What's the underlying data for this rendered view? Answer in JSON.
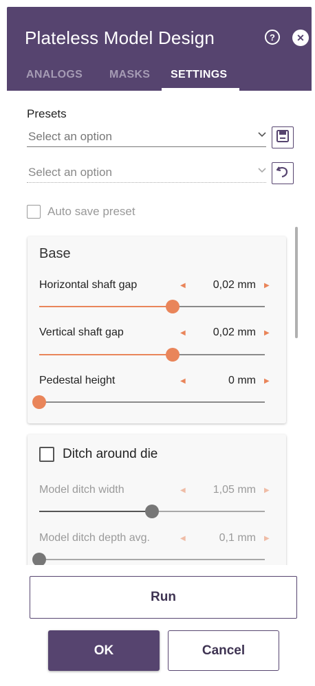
{
  "window": {
    "title": "Plateless Model Design",
    "accent": "#56446f",
    "slider_color": "#e9855a",
    "icons": [
      "help-icon",
      "close-icon",
      "save-icon",
      "undo-icon",
      "chevron-down-icon"
    ]
  },
  "tabs": [
    {
      "label": "ANALOGS",
      "active": false
    },
    {
      "label": "MASKS",
      "active": false
    },
    {
      "label": "SETTINGS",
      "active": true
    }
  ],
  "presets": {
    "label": "Presets",
    "select1_placeholder": "Select an option",
    "select2_placeholder": "Select an option",
    "auto_save_label": "Auto save preset",
    "auto_save_checked": false
  },
  "base": {
    "title": "Base",
    "params": [
      {
        "label": "Horizontal shaft gap",
        "value": "0,02 mm",
        "slider_fraction": 0.59
      },
      {
        "label": "Vertical shaft gap",
        "value": "0,02 mm",
        "slider_fraction": 0.59
      },
      {
        "label": "Pedestal height",
        "value": "0 mm",
        "slider_fraction": 0.0
      }
    ]
  },
  "ditch": {
    "title": "Ditch around die",
    "checked": false,
    "params": [
      {
        "label": "Model ditch width",
        "value": "1,05 mm",
        "slider_fraction": 0.5
      },
      {
        "label": "Model ditch depth avg.",
        "value": "0,1 mm",
        "slider_fraction": 0.0
      }
    ]
  },
  "buttons": {
    "run": "Run",
    "ok": "OK",
    "cancel": "Cancel"
  }
}
